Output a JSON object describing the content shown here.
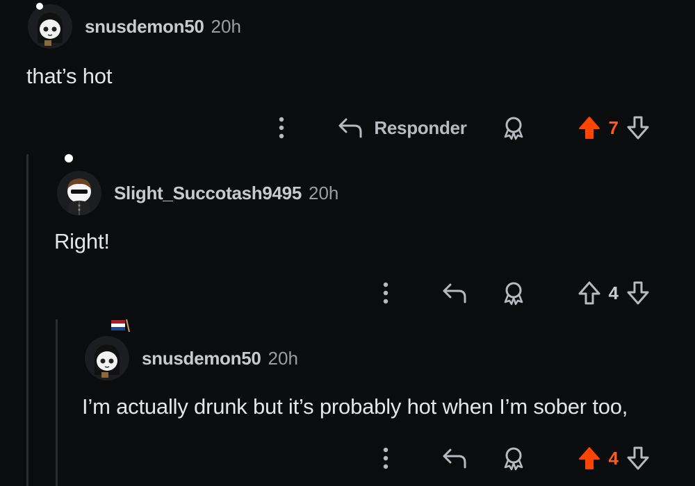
{
  "comments": [
    {
      "username": "snusdemon50",
      "time": "20h",
      "text": "that’s hot",
      "reply_label": "Responder",
      "votes": "7",
      "upvoted": true
    },
    {
      "username": "Slight_Succotash9495",
      "time": "20h",
      "text": "Right!",
      "reply_label": "",
      "votes": "4",
      "upvoted": false
    },
    {
      "username": "snusdemon50",
      "time": "20h",
      "text": "I’m actually drunk but it’s probably hot when I’m sober too,",
      "reply_label": "",
      "votes": "4",
      "upvoted": true
    }
  ],
  "colors": {
    "background": "#0b0c0e",
    "upvote_active": "#ff4500",
    "icon": "#b7bbbf",
    "thread_line": "#2a2c2f"
  },
  "icons": [
    "more-dots-icon",
    "reply-arrow-icon",
    "award-icon",
    "upvote-arrow-icon",
    "downvote-arrow-icon",
    "flag-icon"
  ]
}
